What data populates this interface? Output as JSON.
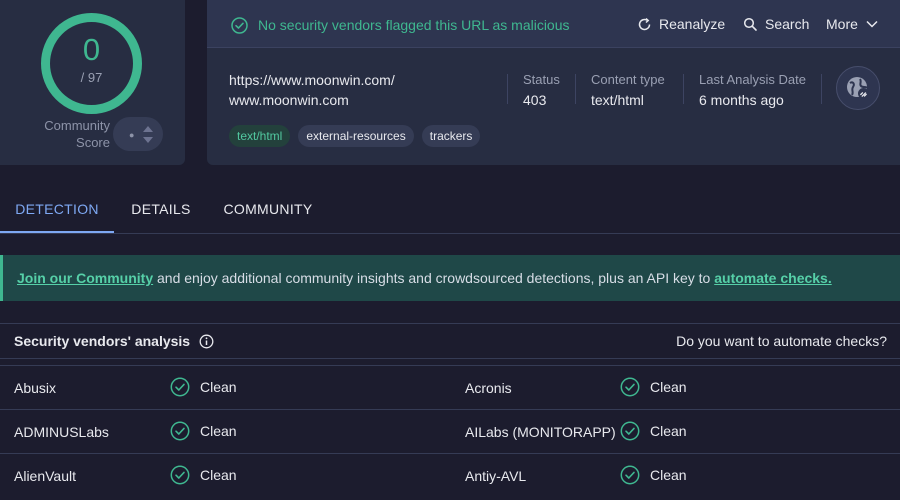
{
  "score": {
    "value": "0",
    "total": "/ 97",
    "community_label_line1": "Community",
    "community_label_line2": "Score",
    "ring_color": "#3fb790"
  },
  "header": {
    "safe_message": "No security vendors flagged this URL as malicious",
    "reanalyze_label": "Reanalyze",
    "search_label": "Search",
    "more_label": "More",
    "url_line1": "https://www.moonwin.com/",
    "url_line2": "www.moonwin.com",
    "status_label": "Status",
    "status_value": "403",
    "content_type_label": "Content type",
    "content_type_value": "text/html",
    "last_analysis_label": "Last Analysis Date",
    "last_analysis_value": "6 months ago",
    "tags": [
      "text/html",
      "external-resources",
      "trackers"
    ]
  },
  "tabs": [
    "DETECTION",
    "DETAILS",
    "COMMUNITY"
  ],
  "banner": {
    "link1": "Join our Community",
    "text": " and enjoy additional community insights and crowdsourced detections, plus an API key to ",
    "link2": "automate checks."
  },
  "vendors": {
    "title": "Security vendors' analysis",
    "automate_question": "Do you want to automate checks?",
    "rows": [
      [
        {
          "name": "Abusix",
          "result": "Clean"
        },
        {
          "name": "Acronis",
          "result": "Clean"
        }
      ],
      [
        {
          "name": "ADMINUSLabs",
          "result": "Clean"
        },
        {
          "name": "AILabs (MONITORAPP)",
          "result": "Clean"
        }
      ],
      [
        {
          "name": "AlienVault",
          "result": "Clean"
        },
        {
          "name": "Antiy-AVL",
          "result": "Clean"
        }
      ]
    ]
  },
  "colors": {
    "accent_green": "#3fb790",
    "accent_blue": "#7ea8f3",
    "background": "#1c1c2e",
    "panel": "#272d42"
  }
}
